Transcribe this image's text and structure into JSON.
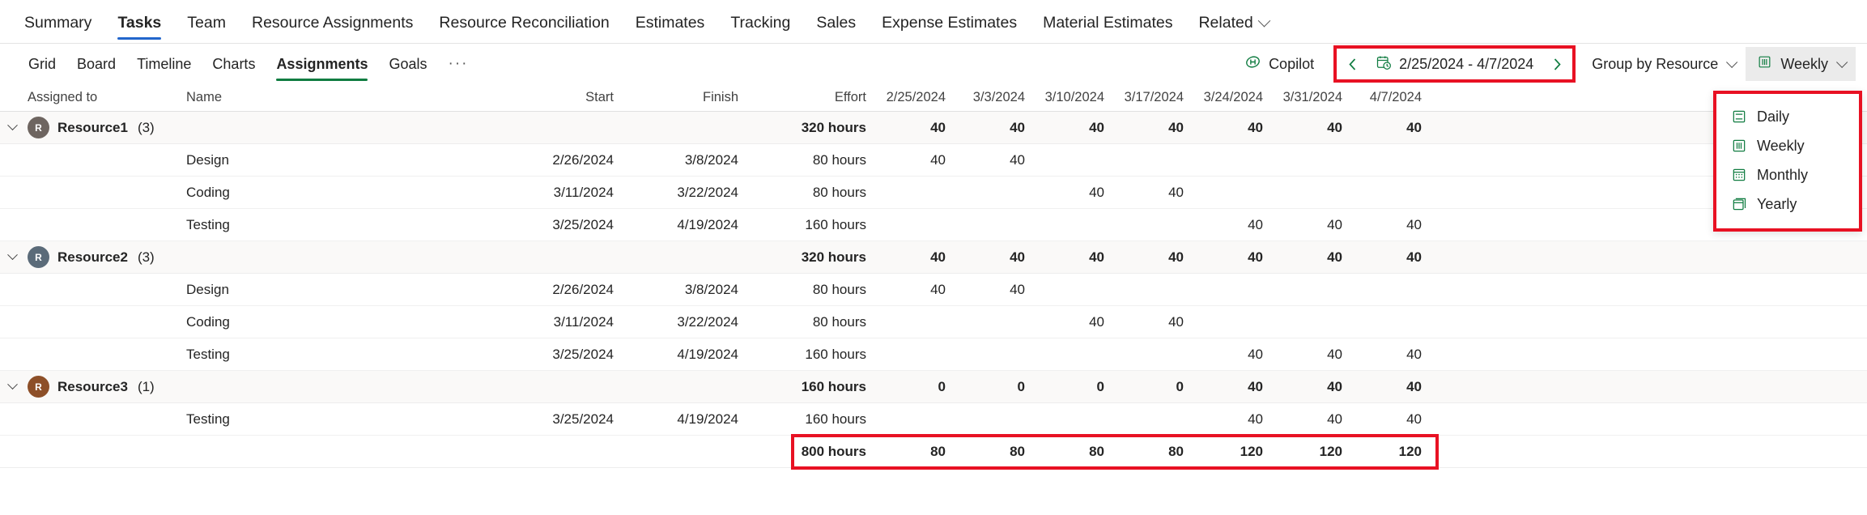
{
  "topnav": {
    "items": [
      {
        "label": "Summary",
        "active": false
      },
      {
        "label": "Tasks",
        "active": true
      },
      {
        "label": "Team",
        "active": false
      },
      {
        "label": "Resource Assignments",
        "active": false
      },
      {
        "label": "Resource Reconciliation",
        "active": false
      },
      {
        "label": "Estimates",
        "active": false
      },
      {
        "label": "Tracking",
        "active": false
      },
      {
        "label": "Sales",
        "active": false
      },
      {
        "label": "Expense Estimates",
        "active": false
      },
      {
        "label": "Material Estimates",
        "active": false
      },
      {
        "label": "Related",
        "active": false,
        "chevron": true
      }
    ]
  },
  "subbar": {
    "tabs": [
      {
        "label": "Grid",
        "active": false
      },
      {
        "label": "Board",
        "active": false
      },
      {
        "label": "Timeline",
        "active": false
      },
      {
        "label": "Charts",
        "active": false
      },
      {
        "label": "Assignments",
        "active": true
      },
      {
        "label": "Goals",
        "active": false
      }
    ],
    "overflow_label": "···",
    "copilot_label": "Copilot",
    "date_range": "2/25/2024 - 4/7/2024",
    "group_by_label": "Group by Resource",
    "scale_label": "Weekly"
  },
  "scale_menu": {
    "items": [
      {
        "label": "Daily",
        "icon": "daily-scale-icon"
      },
      {
        "label": "Weekly",
        "icon": "weekly-scale-icon"
      },
      {
        "label": "Monthly",
        "icon": "monthly-scale-icon"
      },
      {
        "label": "Yearly",
        "icon": "yearly-scale-icon"
      }
    ]
  },
  "grid": {
    "columns": {
      "assigned_to": "Assigned to",
      "name": "Name",
      "start": "Start",
      "finish": "Finish",
      "effort": "Effort"
    },
    "week_headers": [
      "2/25/2024",
      "3/3/2024",
      "3/10/2024",
      "3/17/2024",
      "3/24/2024",
      "3/31/2024",
      "4/7/2024"
    ],
    "rows": [
      {
        "type": "group",
        "avatar": "R",
        "avatar_color": "#6e6560",
        "assigned_to": "Resource1",
        "count": "(3)",
        "name": "",
        "start": "",
        "finish": "",
        "effort": "320 hours",
        "weeks": [
          "40",
          "40",
          "40",
          "40",
          "40",
          "40",
          "40"
        ]
      },
      {
        "type": "task",
        "assigned_to": "",
        "name": "Design",
        "start": "2/26/2024",
        "finish": "3/8/2024",
        "effort": "80 hours",
        "weeks": [
          "40",
          "40",
          "",
          "",
          "",
          "",
          ""
        ]
      },
      {
        "type": "task",
        "assigned_to": "",
        "name": "Coding",
        "start": "3/11/2024",
        "finish": "3/22/2024",
        "effort": "80 hours",
        "weeks": [
          "",
          "",
          "40",
          "40",
          "",
          "",
          ""
        ]
      },
      {
        "type": "task",
        "assigned_to": "",
        "name": "Testing",
        "start": "3/25/2024",
        "finish": "4/19/2024",
        "effort": "160 hours",
        "weeks": [
          "",
          "",
          "",
          "",
          "40",
          "40",
          "40"
        ]
      },
      {
        "type": "group",
        "avatar": "R",
        "avatar_color": "#5b6b79",
        "assigned_to": "Resource2",
        "count": "(3)",
        "name": "",
        "start": "",
        "finish": "",
        "effort": "320 hours",
        "weeks": [
          "40",
          "40",
          "40",
          "40",
          "40",
          "40",
          "40"
        ]
      },
      {
        "type": "task",
        "assigned_to": "",
        "name": "Design",
        "start": "2/26/2024",
        "finish": "3/8/2024",
        "effort": "80 hours",
        "weeks": [
          "40",
          "40",
          "",
          "",
          "",
          "",
          ""
        ]
      },
      {
        "type": "task",
        "assigned_to": "",
        "name": "Coding",
        "start": "3/11/2024",
        "finish": "3/22/2024",
        "effort": "80 hours",
        "weeks": [
          "",
          "",
          "40",
          "40",
          "",
          "",
          ""
        ]
      },
      {
        "type": "task",
        "assigned_to": "",
        "name": "Testing",
        "start": "3/25/2024",
        "finish": "4/19/2024",
        "effort": "160 hours",
        "weeks": [
          "",
          "",
          "",
          "",
          "40",
          "40",
          "40"
        ]
      },
      {
        "type": "group",
        "avatar": "R",
        "avatar_color": "#8d4f28",
        "assigned_to": "Resource3",
        "count": "(1)",
        "name": "",
        "start": "",
        "finish": "",
        "effort": "160 hours",
        "weeks": [
          "0",
          "0",
          "0",
          "0",
          "40",
          "40",
          "40"
        ]
      },
      {
        "type": "task",
        "assigned_to": "",
        "name": "Testing",
        "start": "3/25/2024",
        "finish": "4/19/2024",
        "effort": "160 hours",
        "weeks": [
          "",
          "",
          "",
          "",
          "40",
          "40",
          "40"
        ]
      },
      {
        "type": "total",
        "assigned_to": "",
        "name": "",
        "start": "",
        "finish": "",
        "effort": "800 hours",
        "weeks": [
          "80",
          "80",
          "80",
          "80",
          "120",
          "120",
          "120"
        ]
      }
    ]
  },
  "colors": {
    "accent_blue": "#2266cc",
    "accent_green": "#107c41",
    "highlight_red": "#e81123",
    "group_row_bg": "#faf9f8"
  }
}
